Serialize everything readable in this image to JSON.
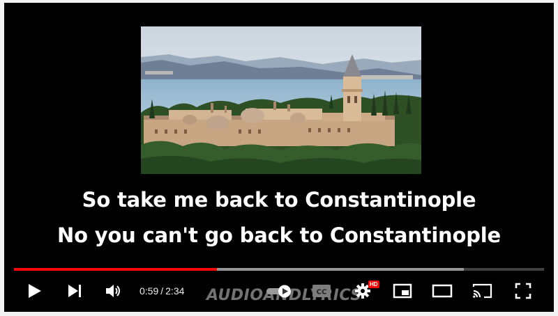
{
  "video": {
    "subtitles": [
      "So take me back to Constantinople",
      "No you can't go back to Constantinople"
    ],
    "watermark": "AUDIOANDLYRICS"
  },
  "player": {
    "current_time": "0:59",
    "duration": "2:34",
    "time_separator": "/",
    "progress_played_fraction": 0.383,
    "progress_buffered_fraction": 0.849,
    "hd_badge": "HD",
    "colors": {
      "progress_played": "#ff0000",
      "hd_badge": "#ff0000",
      "background": "#000000"
    },
    "icons": {
      "play": "play-icon",
      "next": "next-icon",
      "volume": "volume-icon",
      "autoplay": "autoplay-toggle-icon",
      "captions": "captions-icon",
      "settings": "gear-icon",
      "miniplayer": "miniplayer-icon",
      "theater": "theater-mode-icon",
      "cast": "cast-icon",
      "fullscreen": "fullscreen-icon"
    }
  }
}
